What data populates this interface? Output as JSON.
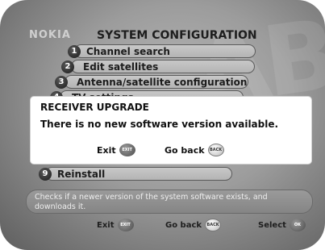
{
  "brand": "NOKIA",
  "title": "SYSTEM CONFIGURATION",
  "menu": {
    "items": [
      {
        "number": "1",
        "label": "Channel search"
      },
      {
        "number": "2",
        "label": "Edit satellites"
      },
      {
        "number": "3",
        "label": "Antenna/satellite configuration"
      },
      {
        "number": "4",
        "label": "TV settings"
      },
      {
        "number": "9",
        "label": "Reinstall"
      }
    ]
  },
  "help_text": "Checks if a newer version of the system software exists, and downloads it.",
  "footer": {
    "exit_label": "Exit",
    "exit_key": "EXIT",
    "back_label": "Go back",
    "back_key": "BACK",
    "select_label": "Select",
    "select_key": "OK"
  },
  "dialog": {
    "title": "RECEIVER UPGRADE",
    "message": "There is no new software version available.",
    "exit_label": "Exit",
    "exit_key": "EXIT",
    "back_label": "Go back",
    "back_key": "BACK"
  }
}
